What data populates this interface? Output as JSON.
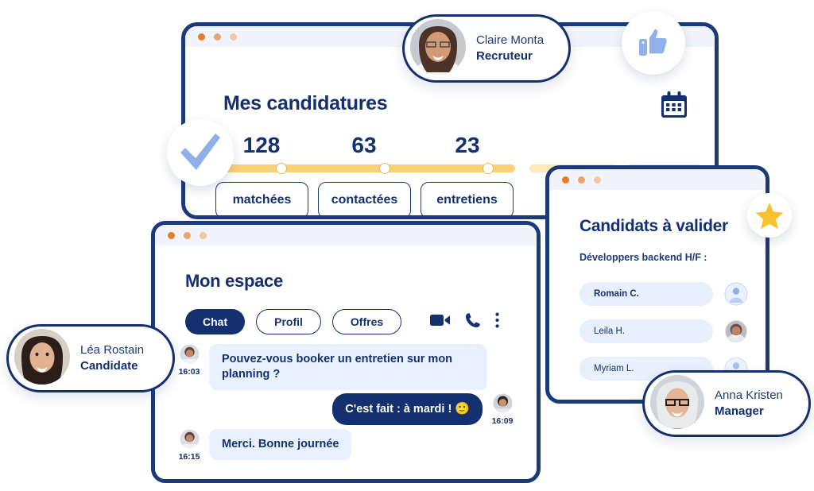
{
  "colors": {
    "navy": "#14306e",
    "navy_border": "#1b3a7a",
    "light_blue_bubble": "#e8f1fd",
    "accent_yellow": "#fbd177",
    "star_yellow": "#fbc02d",
    "thumb_blue": "#8fb0ea",
    "check_blue": "#8fb0ea",
    "titlebar": "#f1f4fc",
    "dot_orange": "#ea7b2b"
  },
  "candidatures_window": {
    "title": "Mes candidatures",
    "calendar_icon": "calendar-icon",
    "traffic_dots": [
      "close-dot",
      "minimize-dot",
      "maximize-dot"
    ],
    "stats": [
      {
        "value": "128",
        "label": "matchées"
      },
      {
        "value": "63",
        "label": "contactées"
      },
      {
        "value": "23",
        "label": "entretiens"
      }
    ],
    "progress": {
      "nodes": 3,
      "filled_percent": 62,
      "segments": [
        "solid",
        "faint",
        "faint"
      ]
    }
  },
  "candidats_window": {
    "title": "Candidats à valider",
    "subtitle": "Développers backend H/F :",
    "star_icon": "star-icon",
    "rows": [
      {
        "name": "Romain C.",
        "avatar": "placeholder-avatar-icon",
        "bold": true
      },
      {
        "name": "Leila H.",
        "avatar": "photo-avatar",
        "bold": false
      },
      {
        "name": "Myriam L.",
        "avatar": "placeholder-avatar-icon",
        "bold": false
      }
    ]
  },
  "espace_window": {
    "title": "Mon espace",
    "tabs": [
      {
        "label": "Chat",
        "active": true
      },
      {
        "label": "Profil",
        "active": false
      },
      {
        "label": "Offres",
        "active": false
      }
    ],
    "actions": [
      {
        "name": "video-call-icon"
      },
      {
        "name": "phone-call-icon"
      },
      {
        "name": "more-options-icon"
      }
    ],
    "messages": [
      {
        "side": "them",
        "text": "Pouvez-vous booker un entretien sur mon planning ?",
        "time": "16:03"
      },
      {
        "side": "me",
        "text": "C'est fait : à mardi !",
        "emoji": "🙂",
        "time": "16:09"
      },
      {
        "side": "them",
        "text": "Merci. Bonne journée",
        "time": "16:15"
      }
    ]
  },
  "badges": [
    {
      "id": "claire",
      "name": "Claire Monta",
      "role": "Recruteur"
    },
    {
      "id": "lea",
      "name": "Léa Rostain",
      "role": "Candidate"
    },
    {
      "id": "anna",
      "name": "Anna Kristen",
      "role": "Manager"
    }
  ],
  "icon_badges": [
    {
      "id": "thumb",
      "icon": "thumbs-up-icon"
    },
    {
      "id": "check",
      "icon": "checkmark-icon"
    },
    {
      "id": "star",
      "icon": "star-icon"
    }
  ]
}
